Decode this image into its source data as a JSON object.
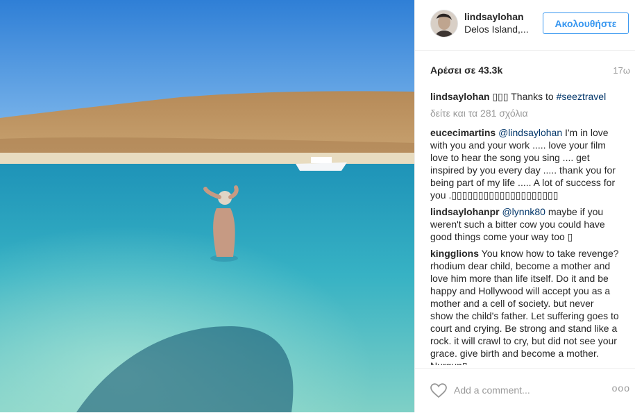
{
  "post": {
    "username": "lindsaylohan",
    "location": "Delos Island,...",
    "follow_label": "Ακολουθήστε",
    "likes": "Αρέσει σε 43.3k",
    "time": "17ω"
  },
  "caption": {
    "username": "lindsaylohan",
    "emoji": "▯▯▯",
    "text": " Thanks to ",
    "hashtag": "#seeztravel"
  },
  "view_all_comments": "δείτε και τα 281 σχόλια",
  "comments": [
    {
      "username": "eucecimartins",
      "mention": "@lindsaylohan",
      "text": " I'm in love with you and your work ..... love your film love to hear the song you sing .... get inspired by you every day ..... thank you for being part of my life ..... A lot of success for you .▯▯▯▯▯▯▯▯▯▯▯▯▯▯▯▯▯▯▯▯"
    },
    {
      "username": "lindsaylohanpr",
      "mention": "@lynnk80",
      "text": " maybe if you weren't such a bitter cow you could have good things come your way too ▯"
    },
    {
      "username": "kingglions",
      "mention": "",
      "text": " You know how to take revenge? rhodium dear child, become a mother and love him more than life itself. Do it and be happy and Hollywood will accept you as a mother and a cell of society. but never show the child's father. Let suffering goes to court and crying. Be strong and stand like a rock. it will crawl to cry, but did not see your grace. give birth and become a mother. Nurgun▯"
    }
  ],
  "footer": {
    "add_comment_placeholder": "Add a comment...",
    "more_label": "ooo"
  },
  "colors": {
    "accent": "#3897f0",
    "link": "#003569",
    "muted": "#999999"
  }
}
